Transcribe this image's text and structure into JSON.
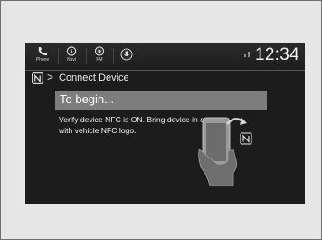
{
  "status_bar": {
    "apps": [
      {
        "label": "Phone",
        "icon": "phone-icon"
      },
      {
        "label": "Navi",
        "icon": "navi-icon"
      },
      {
        "label": "FM",
        "icon": "radio-icon"
      },
      {
        "label": "",
        "icon": "siri-icon"
      }
    ],
    "clock": "12:34"
  },
  "header": {
    "nfc_icon": "nfc-icon",
    "chevron": ">",
    "title": "Connect Device"
  },
  "main": {
    "heading": "To begin...",
    "instruction": "Verify device NFC is ON. Bring device in contact with vehicle NFC logo."
  },
  "colors": {
    "screen_bg": "#1c1c1c",
    "highlight_bar": "#7d7d7d",
    "page_bg": "#e6e6e6"
  }
}
